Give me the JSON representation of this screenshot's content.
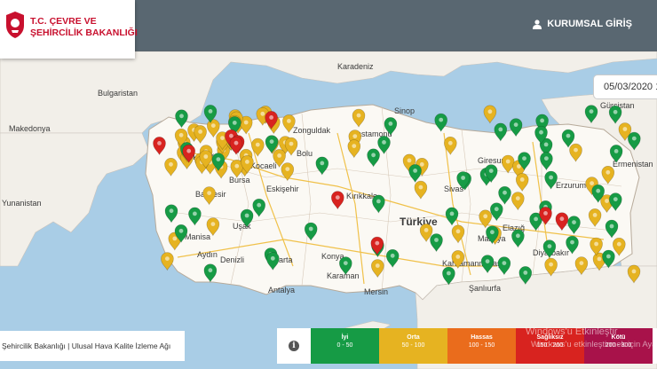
{
  "header": {
    "ministry_line1": "T.C. ÇEVRE VE",
    "ministry_line2": "ŞEHİRCİLİK BAKANLIĞI",
    "login_label": "KURUMSAL GİRİŞ",
    "accent_color": "#c8102e"
  },
  "date_value": "05/03/2020 1",
  "map_labels": [
    {
      "text": "Karadeniz",
      "kind": "sea"
    },
    {
      "text": "Bulgaristan",
      "kind": "country"
    },
    {
      "text": "Makedonya",
      "kind": "country"
    },
    {
      "text": "Yunanistan",
      "kind": "country"
    },
    {
      "text": "Gürcistan",
      "kind": "country"
    },
    {
      "text": "Ermenistan",
      "kind": "country"
    },
    {
      "text": "Türkiye",
      "kind": "country"
    },
    {
      "text": "Sinop",
      "kind": "city"
    },
    {
      "text": "Kastamonu",
      "kind": "city"
    },
    {
      "text": "Zonguldak",
      "kind": "city"
    },
    {
      "text": "Bolu",
      "kind": "city"
    },
    {
      "text": "Kocaeli",
      "kind": "city"
    },
    {
      "text": "Tekirdağ",
      "kind": "city"
    },
    {
      "text": "Bursa",
      "kind": "city"
    },
    {
      "text": "Eskişehir",
      "kind": "city"
    },
    {
      "text": "Balıkesir",
      "kind": "city"
    },
    {
      "text": "Kırıkkale",
      "kind": "city"
    },
    {
      "text": "Sivas",
      "kind": "city"
    },
    {
      "text": "Giresun",
      "kind": "city"
    },
    {
      "text": "Erzurum",
      "kind": "city"
    },
    {
      "text": "Elazığ",
      "kind": "city"
    },
    {
      "text": "Malatya",
      "kind": "city"
    },
    {
      "text": "Diyarbakır",
      "kind": "city"
    },
    {
      "text": "Kahramanmaraş",
      "kind": "city"
    },
    {
      "text": "Şanlıurfa",
      "kind": "city"
    },
    {
      "text": "Mersin",
      "kind": "city"
    },
    {
      "text": "Karaman",
      "kind": "city"
    },
    {
      "text": "Konya",
      "kind": "city"
    },
    {
      "text": "Isparta",
      "kind": "city"
    },
    {
      "text": "Antalya",
      "kind": "city"
    },
    {
      "text": "Denizli",
      "kind": "city"
    },
    {
      "text": "Aydın",
      "kind": "city"
    },
    {
      "text": "Manisa",
      "kind": "city"
    },
    {
      "text": "Uşak",
      "kind": "city"
    }
  ],
  "stations": {
    "green_count": 62,
    "orange_count": 74,
    "red_count": 10
  },
  "footer_credit": "Şehircilik Bakanlığı | Ulusal Hava Kalite İzleme Ağı",
  "legend": [
    {
      "name": "İyi",
      "range": "0 - 50",
      "color": "#169b45"
    },
    {
      "name": "Orta",
      "range": "50 - 100",
      "color": "#e6b321"
    },
    {
      "name": "Hassas",
      "range": "100 - 150",
      "color": "#ea6c1c"
    },
    {
      "name": "Sağlıksız",
      "range": "150 - 200",
      "color": "#d8231f"
    },
    {
      "name": "Kötü",
      "range": "200 - 300",
      "color": "#a8124a"
    }
  ],
  "watermark": {
    "line1": "Windows'u Etkinleştir",
    "line2": "Windows'u etkinleştirmek için Ayarlar"
  }
}
